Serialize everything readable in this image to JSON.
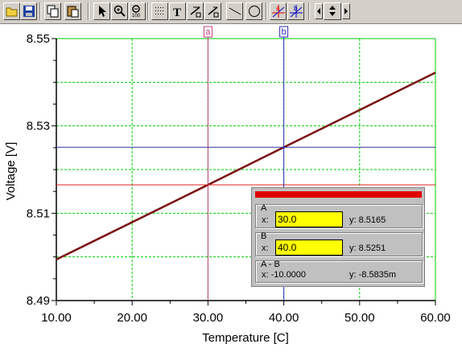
{
  "toolbar": {
    "buttons": [
      {
        "name": "open-icon"
      },
      {
        "name": "save-icon"
      },
      {
        "name": "copy-icon"
      },
      {
        "name": "paste-icon"
      },
      {
        "name": "pointer-icon"
      },
      {
        "name": "zoom-in-icon"
      },
      {
        "name": "zoom-100-icon"
      },
      {
        "name": "grid-icon"
      },
      {
        "name": "text-icon"
      },
      {
        "name": "line-label-icon"
      },
      {
        "name": "line-label2-icon"
      },
      {
        "name": "line-icon"
      },
      {
        "name": "circle-icon"
      },
      {
        "name": "cursor-a-icon"
      },
      {
        "name": "cursor-b-icon"
      }
    ],
    "text_tool_label": "T",
    "zoom_100_label": "100",
    "cursor_a_label": "a",
    "cursor_b_label": "b"
  },
  "chart_data": {
    "type": "line",
    "xlabel": "Temperature [C]",
    "ylabel": "Voltage [V]",
    "xlim": [
      10,
      60
    ],
    "ylim": [
      8.49,
      8.55
    ],
    "x_ticks": [
      "10.00",
      "20.00",
      "30.00",
      "40.00",
      "50.00",
      "60.00"
    ],
    "y_ticks": [
      "8.49",
      "8.51",
      "8.53",
      "8.55"
    ],
    "y_tick_values": [
      8.49,
      8.51,
      8.53,
      8.55
    ],
    "x_tick_values": [
      10,
      20,
      30,
      40,
      50,
      60
    ],
    "grid": true,
    "series": [
      {
        "x": [
          10,
          20,
          30,
          40,
          50,
          60
        ],
        "values": [
          8.4994,
          8.50795,
          8.5165,
          8.5251,
          8.53365,
          8.5422
        ],
        "color": "#7a1010"
      }
    ],
    "cursors": [
      {
        "label": "a",
        "x": 30.0,
        "y": 8.5165,
        "color": "#c04080",
        "hcolor": "#e02020"
      },
      {
        "label": "b",
        "x": 40.0,
        "y": 8.5251,
        "color": "#3030c0",
        "hcolor": "#3030a0"
      }
    ]
  },
  "cursor_panel": {
    "a": {
      "title": "A",
      "x_label": "x:",
      "x_value": "30.0",
      "y_text": "y: 8.5165"
    },
    "b": {
      "title": "B",
      "x_label": "x:",
      "x_value": "40.0",
      "y_text": "y: 8.5251"
    },
    "diff": {
      "title": "A - B",
      "x_text": "x:  -10.0000",
      "y_text": "y: -8.5835m"
    }
  },
  "colors": {
    "grid": "#00cc00",
    "background": "#ffffff",
    "panel_red": "#e00000",
    "input_yellow": "#ffff00"
  }
}
